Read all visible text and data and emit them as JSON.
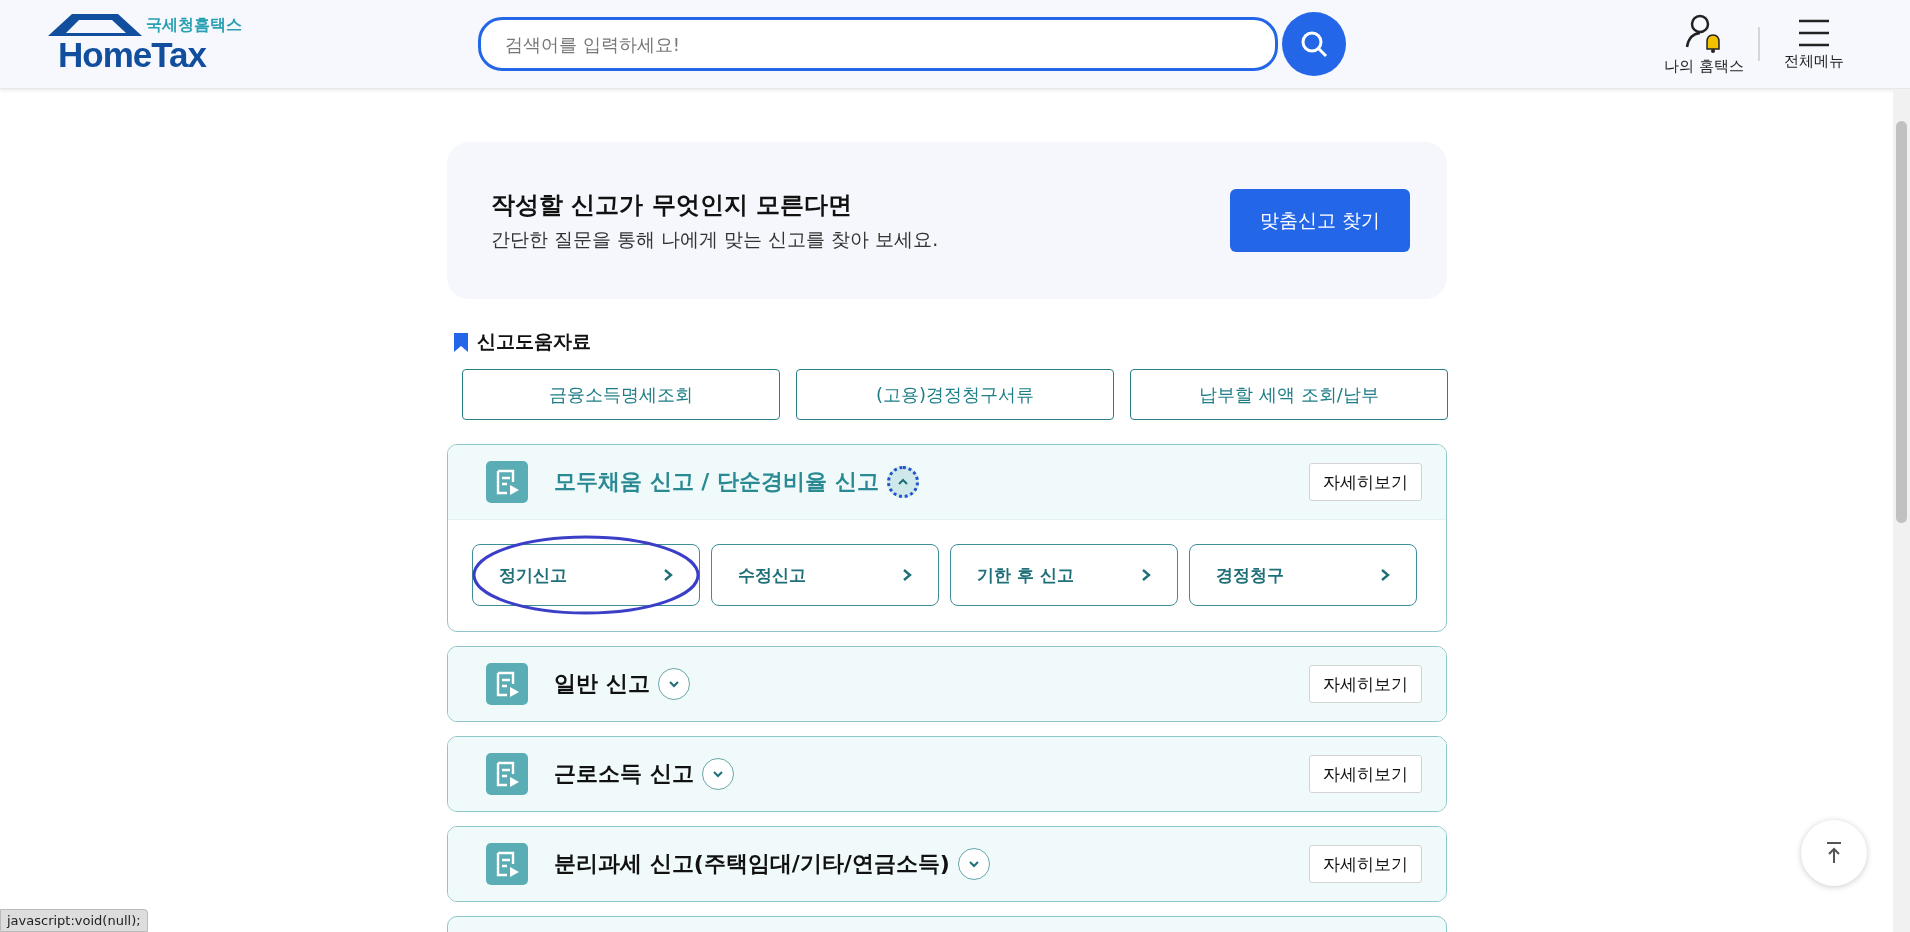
{
  "header": {
    "logo_sub": "국세청홈택스",
    "logo_main": "HomeTax",
    "search": {
      "placeholder": "검색어를 입력하세요!"
    },
    "actions": [
      {
        "kind": "my",
        "label": "나의 홈택스"
      },
      {
        "kind": "menu",
        "label": "전체메뉴"
      }
    ]
  },
  "banner": {
    "title": "작성할 신고가 무엇인지 모른다면",
    "subtitle": "간단한 질문을 통해 나에게 맞는 신고를 찾아 보세요.",
    "button": "맞춤신고 찾기"
  },
  "help": {
    "title": "신고도움자료",
    "links": [
      "금융소득명세조회",
      "(고용)경정청구서류",
      "납부할 세액 조회/납부"
    ]
  },
  "sections": [
    {
      "kind": "accordion",
      "title": "모두채움 신고 / 단순경비율 신고",
      "expanded": true,
      "detail": "자세히보기",
      "items": [
        {
          "label": "정기신고",
          "circled": true
        },
        {
          "label": "수정신고",
          "circled": false
        },
        {
          "label": "기한 후 신고",
          "circled": false
        },
        {
          "label": "경정청구",
          "circled": false
        }
      ]
    },
    {
      "kind": "accordion",
      "title": "일반 신고",
      "expanded": false,
      "detail": "자세히보기"
    },
    {
      "kind": "accordion",
      "title": "근로소득 신고",
      "expanded": false,
      "detail": "자세히보기"
    },
    {
      "kind": "accordion",
      "title": "분리과세 신고(주택임대/기타/연금소득)",
      "expanded": false,
      "detail": "자세히보기"
    },
    {
      "kind": "cut_off"
    }
  ],
  "status_bar": "javascript:void(null);"
}
